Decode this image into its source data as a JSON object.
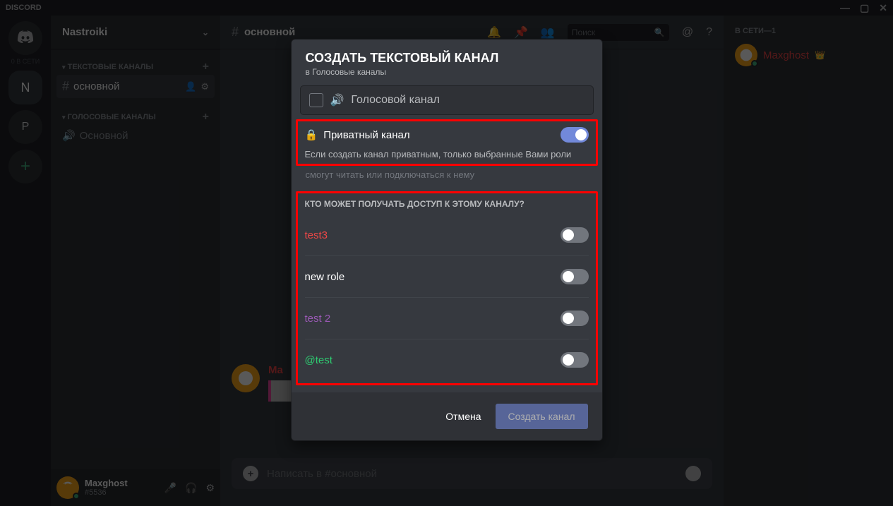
{
  "titlebar": {
    "app": "DISCORD"
  },
  "sidebar": {
    "home_label": "0 В СЕТИ",
    "servers": [
      {
        "letter": "N",
        "selected": true
      },
      {
        "letter": "P",
        "selected": false
      }
    ],
    "add": "+"
  },
  "channels": {
    "server": "Nastroiki",
    "cat_text": "ТЕКСТОВЫЕ КАНАЛЫ",
    "text": [
      {
        "name": "основной",
        "selected": true
      }
    ],
    "cat_voice": "ГОЛОСОВЫЕ КАНАЛЫ",
    "voice": [
      {
        "name": "Основной"
      }
    ]
  },
  "user": {
    "name": "Maxghost",
    "tag": "#5536"
  },
  "chat": {
    "channel": "основной",
    "search_placeholder": "Поиск",
    "input_placeholder": "Написать в #основной",
    "msg_user": "Ma"
  },
  "members": {
    "header": "В СЕТИ—1",
    "list": [
      {
        "name": "Maxghost",
        "crown": true
      }
    ]
  },
  "modal": {
    "title": "Создать текстовый канал",
    "subtitle": "в Голосовые каналы",
    "voice_label": "Голосовой канал",
    "private_label": "Приватный канал",
    "private_on": true,
    "private_desc_in": "Если создать канал приватным, только выбранные Вами роли",
    "private_desc_out": "смогут читать или подключаться к нему",
    "access_title": "КТО МОЖЕТ ПОЛУЧАТЬ ДОСТУП К ЭТОМУ КАНАЛУ?",
    "roles": [
      {
        "name": "test3",
        "color": "#f04747",
        "on": false
      },
      {
        "name": "new role",
        "color": "#ffffff",
        "on": false
      },
      {
        "name": "test 2",
        "color": "#9b59b6",
        "on": false
      },
      {
        "name": "@test",
        "color": "#2ecc71",
        "on": false
      }
    ],
    "cancel": "Отмена",
    "create": "Создать канал"
  }
}
